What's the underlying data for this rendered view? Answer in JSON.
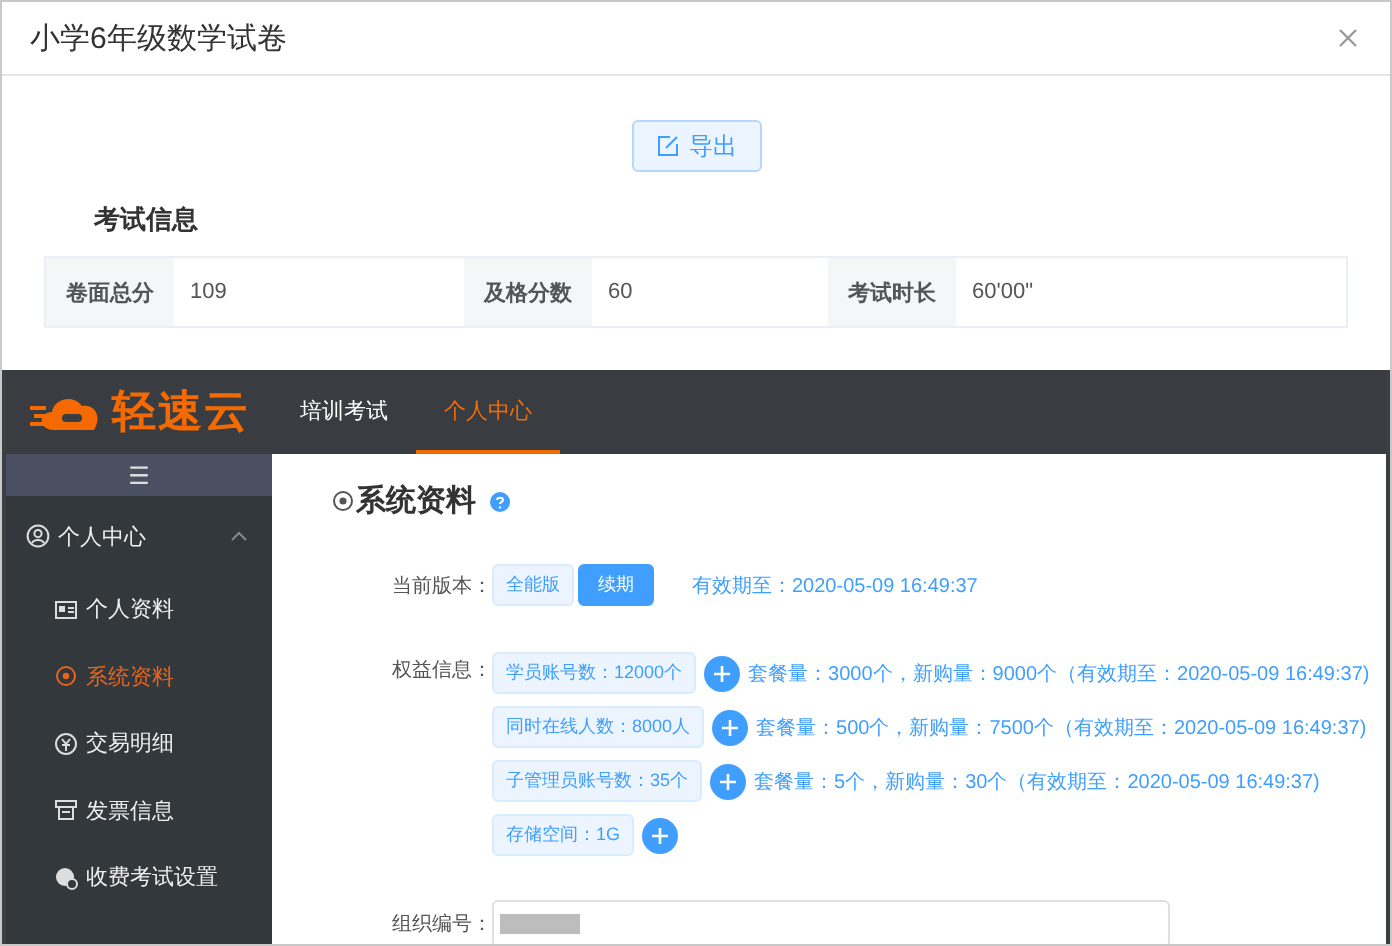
{
  "dialog": {
    "title": "小学6年级数学试卷",
    "export_button": "导出",
    "section_title": "考试信息",
    "info": [
      {
        "label": "卷面总分",
        "value": "109"
      },
      {
        "label": "及格分数",
        "value": "60"
      },
      {
        "label": "考试时长",
        "value": "60'00\""
      }
    ]
  },
  "app": {
    "logo": "轻速云",
    "nav": [
      {
        "label": "培训考试",
        "selected": false
      },
      {
        "label": "个人中心",
        "selected": true
      }
    ],
    "sidebar": {
      "menu_icon": "☰",
      "group": {
        "label": "个人中心",
        "expanded": true,
        "children": [
          {
            "label": "个人资料",
            "selected": false
          },
          {
            "label": "系统资料",
            "selected": true
          },
          {
            "label": "交易明细",
            "selected": false
          },
          {
            "label": "发票信息",
            "selected": false
          },
          {
            "label": "收费考试设置",
            "selected": false
          }
        ]
      }
    },
    "page_title": "系统资料",
    "version": {
      "label": "当前版本：",
      "options": [
        {
          "label": "全能版",
          "kind": "tag"
        },
        {
          "label": "续期",
          "kind": "button"
        }
      ],
      "expiry": "有效期至：2020-05-09 16:49:37"
    },
    "rights": {
      "label": "权益信息：",
      "items": [
        {
          "tag": "学员账号数：12000个",
          "detail": "套餐量：3000个，新购量：9000个（有效期至：2020-05-09 16:49:37)"
        },
        {
          "tag": "同时在线人数：8000人",
          "detail": "套餐量：500个，新购量：7500个（有效期至：2020-05-09 16:49:37)"
        },
        {
          "tag": "子管理员账号数：35个",
          "detail": "套餐量：5个，新购量：30个（有效期至：2020-05-09 16:49:37)"
        },
        {
          "tag": "存储空间：1G"
        }
      ]
    },
    "org": {
      "label": "组织编号：",
      "redacted": true
    }
  }
}
